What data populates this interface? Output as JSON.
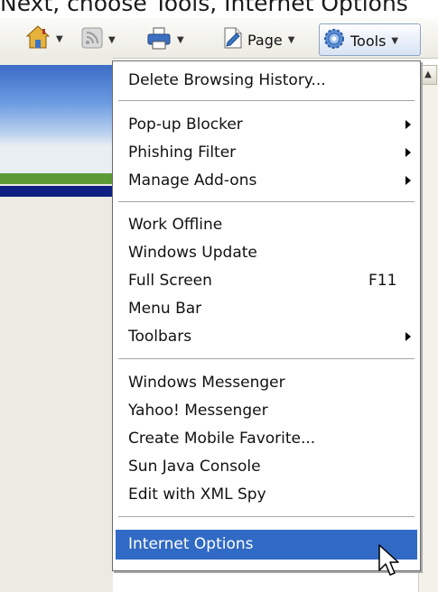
{
  "caption": "Next, choose Tools, Internet Options",
  "toolbar": {
    "items": [
      {
        "name": "home",
        "icon": "home-icon",
        "label": ""
      },
      {
        "name": "feeds",
        "icon": "feeds-icon",
        "label": ""
      },
      {
        "name": "print",
        "icon": "print-icon",
        "label": ""
      },
      {
        "name": "page",
        "icon": "page-icon",
        "label": "Page"
      },
      {
        "name": "tools",
        "icon": "gear-icon",
        "label": "Tools"
      }
    ]
  },
  "menu": {
    "groups": [
      [
        {
          "label": "Delete Browsing History...",
          "submenu": false
        }
      ],
      [
        {
          "label": "Pop-up Blocker",
          "submenu": true
        },
        {
          "label": "Phishing Filter",
          "submenu": true
        },
        {
          "label": "Manage Add-ons",
          "submenu": true
        }
      ],
      [
        {
          "label": "Work Offline",
          "submenu": false
        },
        {
          "label": "Windows Update",
          "submenu": false
        },
        {
          "label": "Full Screen",
          "shortcut": "F11",
          "submenu": false
        },
        {
          "label": "Menu Bar",
          "submenu": false
        },
        {
          "label": "Toolbars",
          "submenu": true
        }
      ],
      [
        {
          "label": "Windows Messenger",
          "submenu": false
        },
        {
          "label": "Yahoo! Messenger",
          "submenu": false
        },
        {
          "label": "Create Mobile Favorite...",
          "submenu": false
        },
        {
          "label": "Sun Java Console",
          "submenu": false
        },
        {
          "label": "Edit with XML Spy",
          "submenu": false
        }
      ],
      [
        {
          "label": "Internet Options",
          "submenu": false,
          "highlighted": true
        }
      ]
    ]
  },
  "colors": {
    "highlight": "#316ac5",
    "highlight_text": "#ffffff"
  }
}
